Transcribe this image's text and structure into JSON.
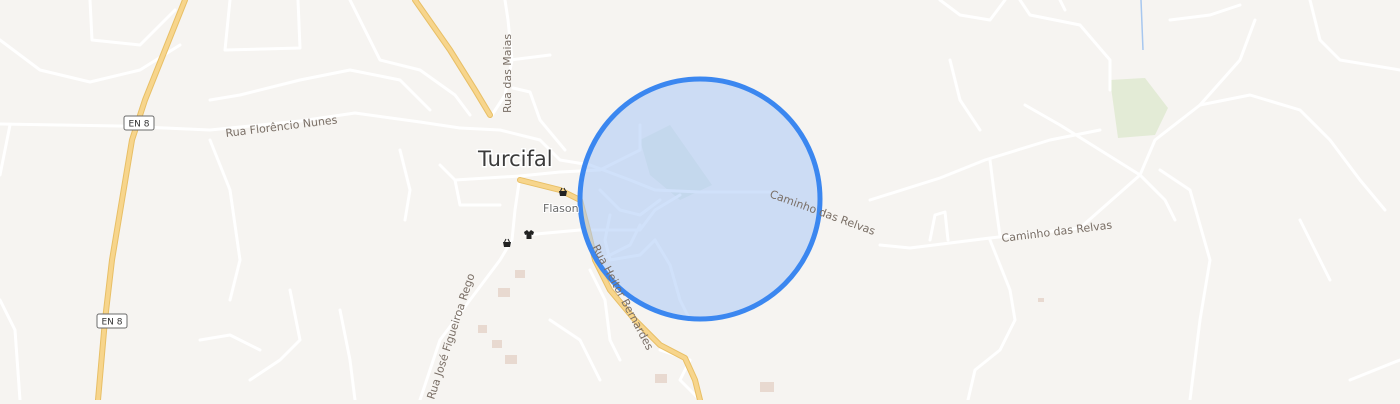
{
  "map": {
    "place_label": "Turcifal",
    "poi_label": "Flason",
    "road_labels": {
      "rua_florencio_nunes": "Rua Florêncio Nunes",
      "rua_das_maias": "Rua das Maias",
      "caminho_das_relvas_1": "Caminho das Relvas",
      "caminho_das_relvas_2": "Caminho das Relvas",
      "rua_heitor_bernardes": "Rua Heitor Bernardes",
      "rua_jose_figueiroa_rego": "Rua José Figueiroa Rego"
    },
    "shields": {
      "en8_top": "EN 8",
      "en8_bottom": "EN 8"
    },
    "icons": [
      "shopping-basket-icon",
      "shopping-basket-icon",
      "clothing-icon"
    ],
    "colors": {
      "background": "#f6f4f1",
      "minor_road": "#ffffff",
      "major_road": "#f7d58c",
      "major_road_casing": "#e8bf66",
      "park": "#e3ebd6",
      "water": "#a7c7ef",
      "building": "#e8d9d0",
      "circle_fill": "#a9c8f5",
      "circle_stroke": "#3b87f0"
    }
  }
}
